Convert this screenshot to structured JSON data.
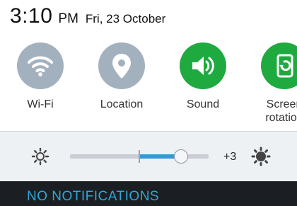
{
  "status": {
    "time": "3:10",
    "ampm": "PM",
    "date": "Fri, 23 October"
  },
  "quick_settings": [
    {
      "label": "Wi-Fi",
      "state": "off",
      "icon": "wifi-icon"
    },
    {
      "label": "Location",
      "state": "off",
      "icon": "location-pin-icon"
    },
    {
      "label": "Sound",
      "state": "on",
      "icon": "speaker-icon"
    },
    {
      "label_line1": "Screen",
      "label_line2": "rotation",
      "state": "on",
      "icon": "screen-rotation-icon"
    }
  ],
  "brightness": {
    "level_text": "+3",
    "min_icon": "sun-outline-icon",
    "max_icon": "sun-filled-icon"
  },
  "notifications": {
    "empty_text": "NO NOTIFICATIONS"
  },
  "colors": {
    "tile_off": "#a3b1bf",
    "tile_on": "#1faa3f",
    "slider_fill": "#2e9bd9",
    "notification_text": "#2fa7d4"
  }
}
